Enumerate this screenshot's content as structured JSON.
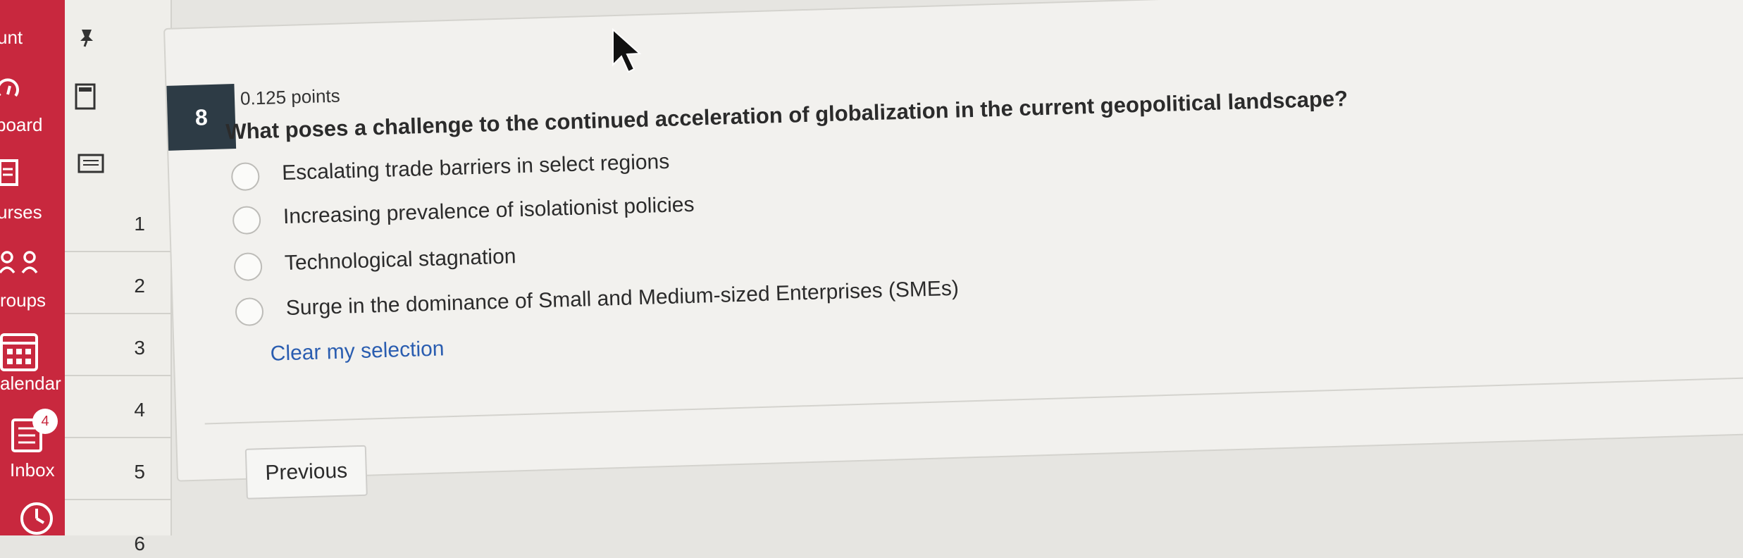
{
  "global_nav": {
    "items": [
      {
        "label": "unt",
        "icon": "account-icon"
      },
      {
        "label": "board",
        "icon": "dashboard-icon"
      },
      {
        "label": "urses",
        "icon": "courses-icon"
      },
      {
        "label": "roups",
        "icon": "groups-icon"
      },
      {
        "label": "alendar",
        "icon": "calendar-icon"
      },
      {
        "label": "Inbox",
        "icon": "inbox-icon",
        "badge": "4"
      },
      {
        "label": "",
        "icon": "history-clock-icon"
      }
    ],
    "color": "#c8283e"
  },
  "question_strip": {
    "icons": [
      "pin-icon",
      "flag-icon",
      "notes-icon"
    ],
    "numbers": [
      "1",
      "2",
      "3",
      "4",
      "5",
      "6"
    ]
  },
  "question": {
    "number": "8",
    "points": "0.125 points",
    "text": "What poses a challenge to the continued acceleration of globalization in the current geopolitical landscape?",
    "answers": [
      "Escalating trade barriers in select regions",
      "Increasing prevalence of isolationist policies",
      "Technological stagnation",
      "Surge in the dominance of Small and Medium-sized Enterprises (SMEs)"
    ],
    "clear_label": "Clear my selection"
  },
  "navigation": {
    "previous_label": "Previous"
  }
}
